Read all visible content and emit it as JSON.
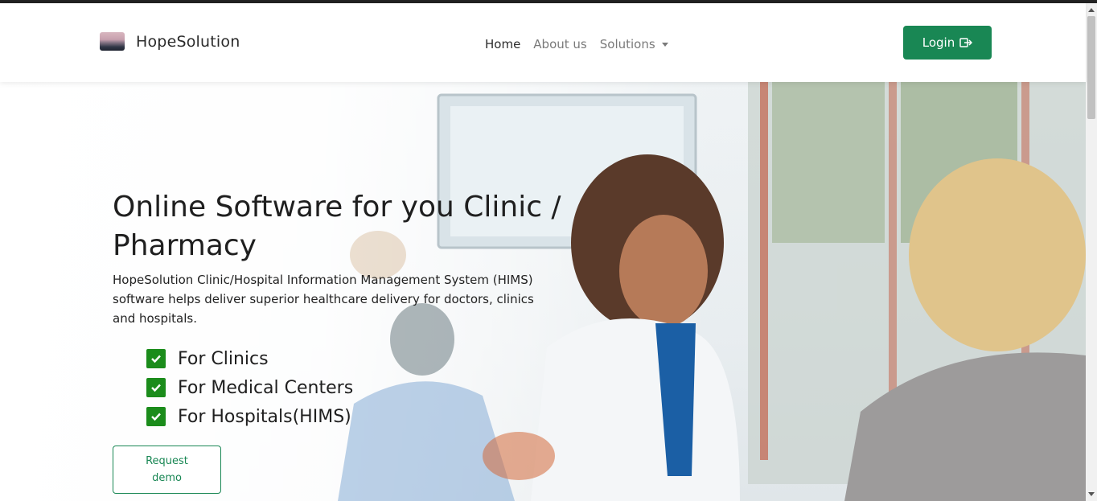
{
  "navbar": {
    "brand": "HopeSolution",
    "links": [
      {
        "label": "Home",
        "active": true
      },
      {
        "label": "About us",
        "active": false
      },
      {
        "label": "Solutions",
        "active": false
      }
    ],
    "login_label": "Login",
    "login_icon": "sign-out-icon"
  },
  "hero": {
    "title": "Online Software for you Clinic / Pharmacy",
    "description": "HopeSolution Clinic/Hospital Information Management System (HIMS) software helps deliver superior healthcare delivery for doctors, clinics and hospitals.",
    "features": [
      "For Clinics",
      "For Medical Centers",
      "For Hospitals(HIMS)"
    ],
    "demo_label": "Request demo"
  },
  "colors": {
    "accent": "#198754",
    "check": "#1b8c1b"
  }
}
